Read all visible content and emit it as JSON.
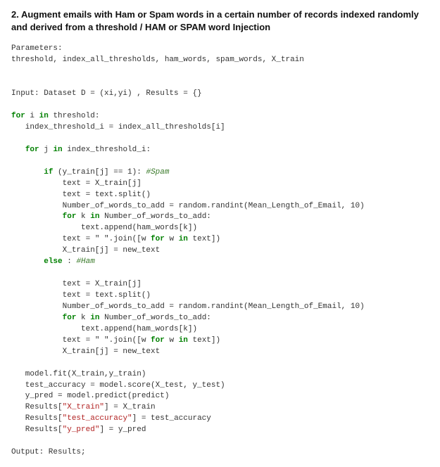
{
  "title": "2. Augment emails with Ham or Spam words in a certain number of records indexed randomly and derived from a threshold / HAM or SPAM word Injection",
  "params_label": "Parameters:",
  "params_list": "threshold, index_all_thresholds, ham_words, spam_words, X_train",
  "input_line": "Input: Dataset D = (xi,yi) , Results = {}",
  "kw": {
    "for": "for",
    "in": "in",
    "if": "if",
    "else": "else"
  },
  "comments": {
    "spam": "#Spam",
    "ham": "#Ham"
  },
  "code": {
    "loop1_var": "i",
    "loop1_iter": "threshold:",
    "assign1": "   index_threshold_i = index_all_thresholds[i]",
    "loop2_var": "j",
    "loop2_iter": "index_threshold_i:",
    "if_cond": "(y_train[j] == 1):",
    "body1_1": "           text = X_train[j]",
    "body1_2": "           text = text.split()",
    "body1_3": "           Number_of_words_to_add = random.randint(Mean_Length_of_Email, 10)",
    "loop3_var": "k",
    "loop3_iter": "Number_of_words_to_add:",
    "body1_4": "               text.append(ham_words[k])",
    "body1_5": "           text = \" \".join([w",
    "body1_5_var": "w",
    "body1_5_end": "text])",
    "body1_6": "           X_train[j] = new_text",
    "else_colon": ":",
    "body2_1": "           text = X_train[j]",
    "body2_2": "           text = text.split()",
    "body2_3": "           Number_of_words_to_add = random.randint(Mean_Length_of_Email, 10)",
    "body2_4": "               text.append(ham_words[k])",
    "body2_5": "           text = \" \".join([w",
    "body2_6": "           X_train[j] = new_text",
    "post1": "   model.fit(X_train,y_train)",
    "post2": "   test_accuracy = model.score(X_test, y_test)",
    "post3": "   y_pred = model.predict(predict)",
    "post4a": "   Results[",
    "post4b": "] = X_train",
    "post5a": "   Results[",
    "post5b": "] = test_accuracy",
    "post6a": "   Results[",
    "post6b": "] = y_pred"
  },
  "strings": {
    "x_train": "\"X_train\"",
    "test_acc": "\"test_accuracy\"",
    "y_pred": "\"y_pred\""
  },
  "output_line": "Output: Results;"
}
